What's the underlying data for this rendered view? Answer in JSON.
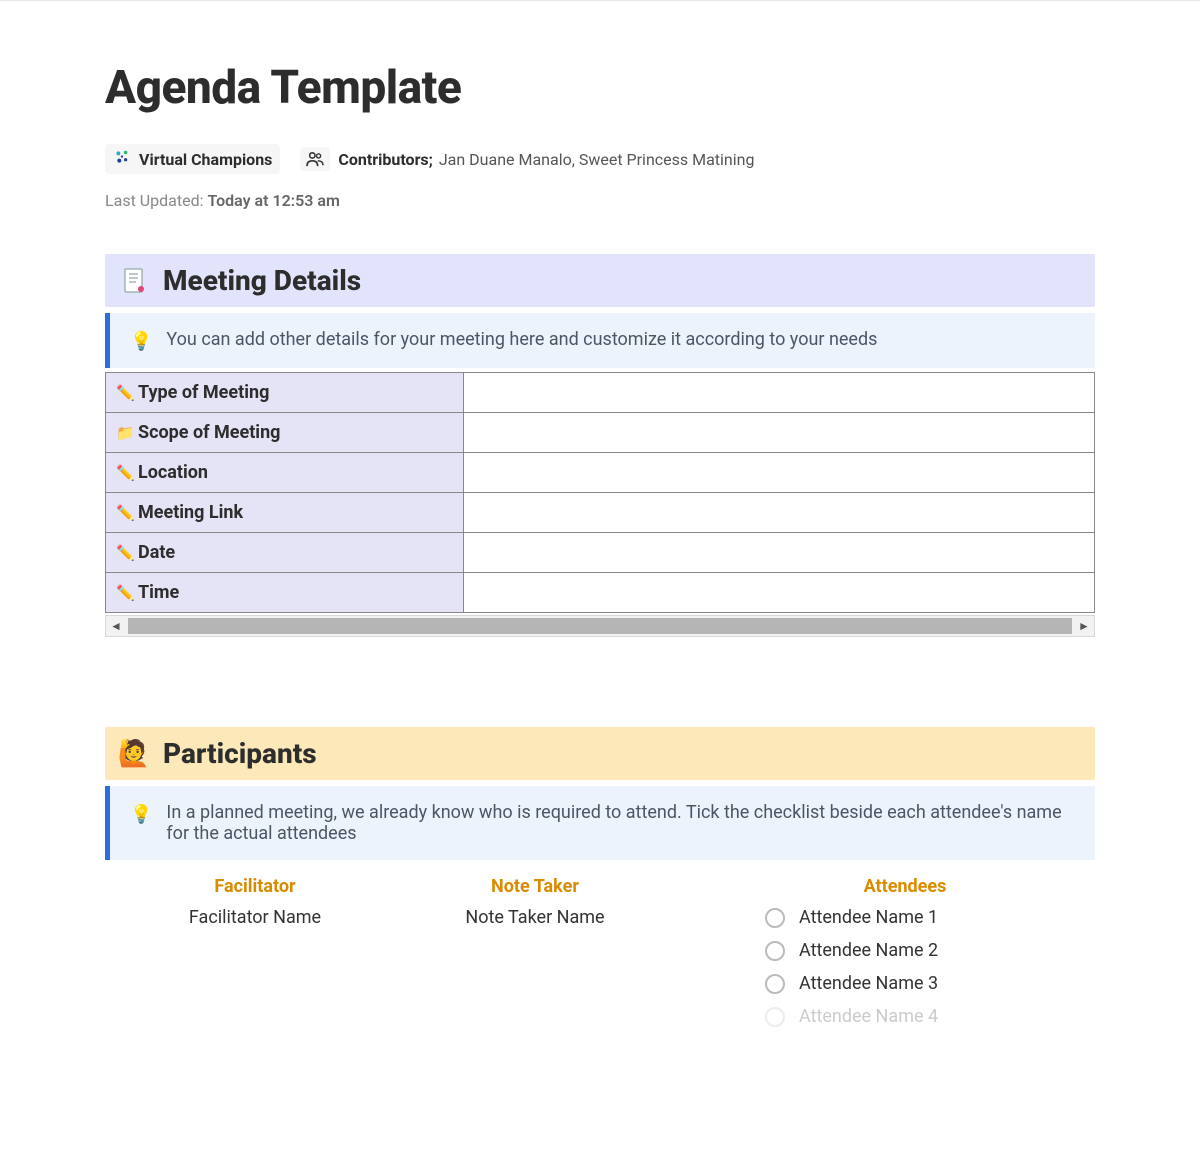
{
  "page": {
    "title": "Agenda Template"
  },
  "meta": {
    "org_name": "Virtual Champions",
    "contributors_label": "Contributors",
    "contributors_names": "Jan Duane Manalo, Sweet Princess Matining",
    "last_updated_label": "Last Updated:",
    "last_updated_value": "Today at 12:53 am"
  },
  "sections": {
    "meeting_details": {
      "title": "Meeting Details",
      "callout": "You can add other details for your meeting here and customize it according to your needs",
      "rows": [
        {
          "icon": "pencil",
          "label": "Type of Meeting",
          "value": ""
        },
        {
          "icon": "folder",
          "label": "Scope of Meeting",
          "value": ""
        },
        {
          "icon": "pencil",
          "label": "Location",
          "value": ""
        },
        {
          "icon": "pencil",
          "label": "Meeting Link",
          "value": ""
        },
        {
          "icon": "pencil",
          "label": "Date",
          "value": ""
        },
        {
          "icon": "pencil",
          "label": "Time",
          "value": ""
        }
      ]
    },
    "participants": {
      "title": "Participants",
      "callout": "In a planned meeting, we already know who is required to attend. Tick the checklist beside each attendee's name for the actual attendees",
      "facilitator_header": "Facilitator",
      "facilitator_name": "Facilitator Name",
      "notetaker_header": "Note Taker",
      "notetaker_name": "Note Taker Name",
      "attendees_header": "Attendees",
      "attendees": [
        "Attendee Name 1",
        "Attendee Name 2",
        "Attendee Name 3",
        "Attendee Name 4"
      ]
    }
  }
}
